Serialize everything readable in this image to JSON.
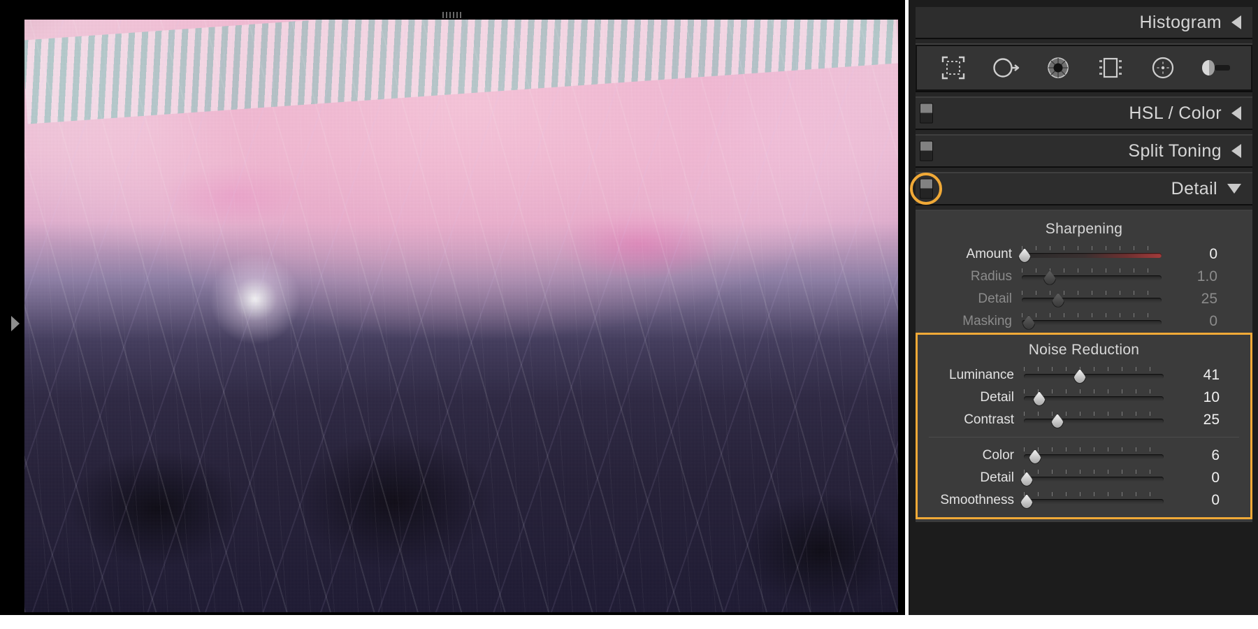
{
  "app": {
    "name": "photo-editor-develop-module",
    "accent_orange": "#f0a937",
    "panel_bg": "#1c1c1c",
    "section_bg": "#3b3b3b"
  },
  "image_area": {
    "name": "carousel-night-photo",
    "expand_arrow_icon": "triangle-right-icon",
    "top_grip_icon": "drag-grip-icon"
  },
  "panels": {
    "histogram": {
      "title": "Histogram",
      "collapse_icon": "triangle-left-icon",
      "expanded": false
    },
    "tools": [
      {
        "name": "crop-overlay-tool",
        "icon": "crop-icon"
      },
      {
        "name": "spot-removal-tool",
        "icon": "spot-removal-icon"
      },
      {
        "name": "red-eye-correction-tool",
        "icon": "eye-icon"
      },
      {
        "name": "graduated-filter-tool",
        "icon": "graduated-filter-icon"
      },
      {
        "name": "radial-filter-tool",
        "icon": "radial-filter-icon"
      },
      {
        "name": "adjustment-brush-tool",
        "icon": "brush-icon"
      }
    ],
    "hsl_color": {
      "title": "HSL / Color",
      "collapse_icon": "triangle-left-icon",
      "expanded": false
    },
    "split_toning": {
      "title": "Split Toning",
      "collapse_icon": "triangle-left-icon",
      "expanded": false
    },
    "detail": {
      "title": "Detail",
      "collapse_icon": "triangle-down-icon",
      "expanded": true,
      "toggle_highlighted": true,
      "sharpening": {
        "title": "Sharpening",
        "sliders": [
          {
            "label": "Amount",
            "value": "0",
            "pos_pct": 2,
            "active": true,
            "track": "red"
          },
          {
            "label": "Radius",
            "value": "1.0",
            "pos_pct": 20,
            "active": false,
            "track": "plain"
          },
          {
            "label": "Detail",
            "value": "25",
            "pos_pct": 26,
            "active": false,
            "track": "plain"
          },
          {
            "label": "Masking",
            "value": "0",
            "pos_pct": 5,
            "active": false,
            "track": "plain"
          }
        ]
      },
      "noise_reduction": {
        "title": "Noise Reduction",
        "highlighted": true,
        "luminance_group": [
          {
            "label": "Luminance",
            "value": "41",
            "pos_pct": 40,
            "active": true,
            "track": "plain"
          },
          {
            "label": "Detail",
            "value": "10",
            "pos_pct": 11,
            "active": true,
            "track": "plain"
          },
          {
            "label": "Contrast",
            "value": "25",
            "pos_pct": 24,
            "active": true,
            "track": "plain"
          }
        ],
        "color_group": [
          {
            "label": "Color",
            "value": "6",
            "pos_pct": 8,
            "active": true,
            "track": "plain"
          },
          {
            "label": "Detail",
            "value": "0",
            "pos_pct": 2,
            "active": true,
            "track": "plain"
          },
          {
            "label": "Smoothness",
            "value": "0",
            "pos_pct": 2,
            "active": true,
            "track": "plain"
          }
        ]
      }
    }
  }
}
